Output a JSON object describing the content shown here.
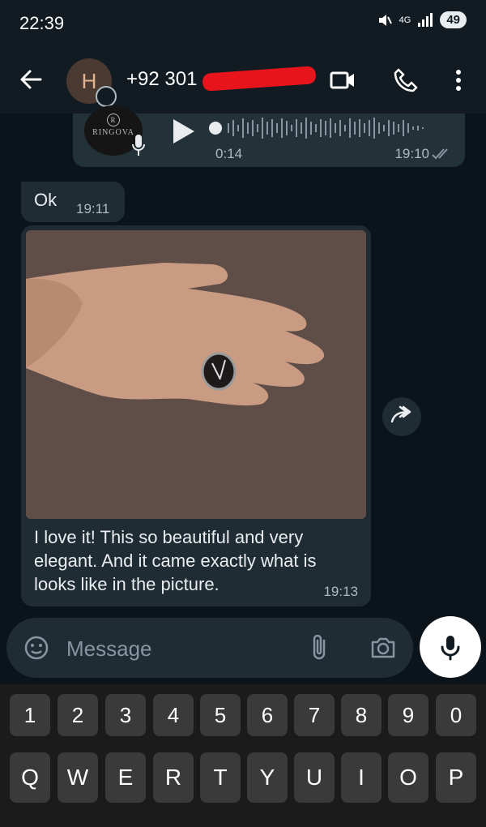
{
  "status": {
    "time": "22:39",
    "network": "4G",
    "battery": "49"
  },
  "header": {
    "avatar_letter": "H",
    "contact": "+92 301"
  },
  "messages": {
    "audio": {
      "brand": "RINGOVA",
      "brand_mark": "R",
      "duration": "0:14",
      "time": "19:10"
    },
    "ok": {
      "text": "Ok",
      "time": "19:11"
    },
    "photo": {
      "caption": "I love it! This so beautiful and very elegant. And it came exactly what is looks like in the picture.",
      "time": "19:13"
    }
  },
  "composer": {
    "placeholder": "Message"
  },
  "keyboard": {
    "numbers": [
      "1",
      "2",
      "3",
      "4",
      "5",
      "6",
      "7",
      "8",
      "9",
      "0"
    ],
    "letters": [
      "Q",
      "W",
      "E",
      "R",
      "T",
      "Y",
      "U",
      "I",
      "O",
      "P"
    ]
  },
  "colors": {
    "background": "#0b141a",
    "bubble": "#202c33",
    "header": "#111b21",
    "mic_button": "#ffffff"
  }
}
